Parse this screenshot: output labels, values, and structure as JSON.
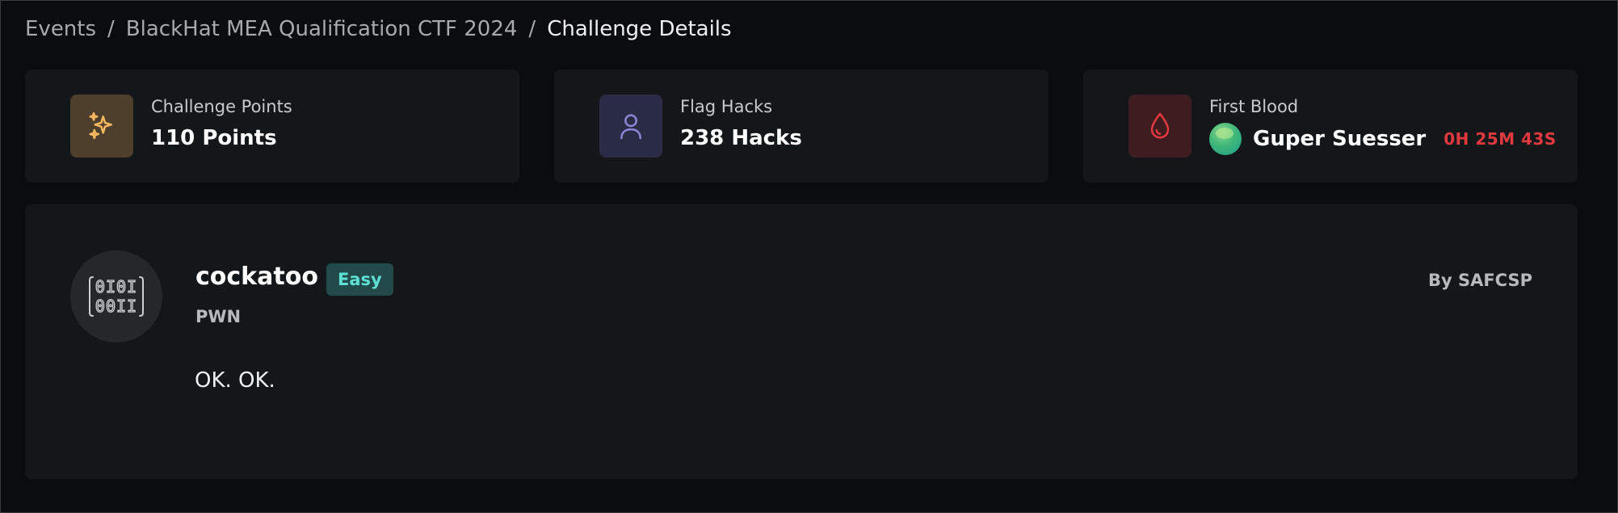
{
  "breadcrumb": {
    "items": [
      "Events",
      "BlackHat MEA Qualification CTF 2024"
    ],
    "separator": "/",
    "current": "Challenge Details"
  },
  "stats": {
    "points": {
      "label": "Challenge Points",
      "value": "110 Points",
      "icon": "sparkles-icon",
      "accent": "#f5b860"
    },
    "hacks": {
      "label": "Flag Hacks",
      "value": "238 Hacks",
      "icon": "user-icon",
      "accent": "#8d86d8"
    },
    "first_blood": {
      "label": "First Blood",
      "user": "Guper Suesser",
      "time": "0H 25M 43S",
      "icon": "droplet-icon",
      "accent": "#e0393e"
    }
  },
  "challenge": {
    "name": "cockatoo",
    "difficulty": "Easy",
    "category": "PWN",
    "author": "By SAFCSP",
    "description": "OK. OK.",
    "icon": "binary-code-icon"
  }
}
